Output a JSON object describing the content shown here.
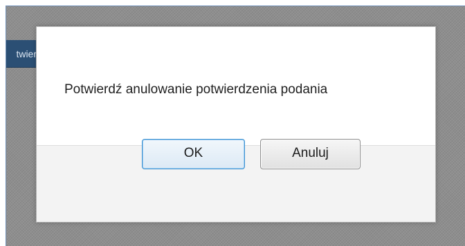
{
  "background": {
    "tab_label": "twier"
  },
  "dialog": {
    "message": "Potwierdź anulowanie potwierdzenia podania",
    "ok_label": "OK",
    "cancel_label": "Anuluj"
  },
  "colors": {
    "backdrop": "#8e8e8e",
    "tab": "#2b4f74",
    "ok_border": "#3c91d2"
  }
}
